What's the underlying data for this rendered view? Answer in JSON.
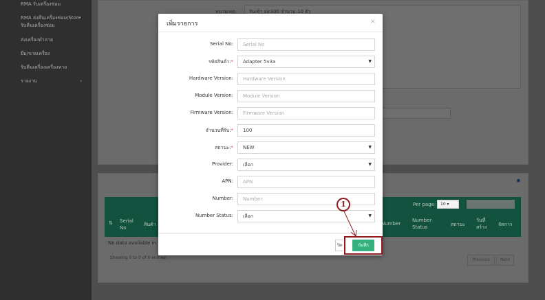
{
  "sidebar": {
    "items": [
      {
        "label": "RMA รับเครื่องซ่อม"
      },
      {
        "label": "RMA ส่งคืนเครื่องซ่อม/Store"
      },
      {
        "label": "รับคืนเครื่องซ่อม"
      },
      {
        "label": "ส่งเครื่องทำลาย"
      },
      {
        "label": "ยืม/ขายเครื่อง"
      },
      {
        "label": "รับคืนเครื่องเครื่องหาย"
      },
      {
        "label": "รายงาน",
        "arrow": "›"
      }
    ]
  },
  "background": {
    "note_label": "หมายเหตุ:",
    "note_value": "รับเข้า air300 จำนวน 10 ตัว",
    "table": {
      "per_page_label": "Per page:",
      "per_page_value": "10",
      "columns": [
        "Serial No",
        "สินค้า",
        "Number",
        "Number Status",
        "สถานะ",
        "วันที่สร้าง",
        "จัดการ"
      ],
      "empty_text": "No data available in t",
      "info_text": "Showing 0 to 0 of 0 entries",
      "previous_label": "Previous",
      "next_label": "Next"
    },
    "gear_icon": "gear-icon"
  },
  "modal": {
    "title": "เพิ่มรายการ",
    "close_glyph": "×",
    "fields": {
      "serial_no": {
        "label": "Serial No:",
        "placeholder": "Serial No",
        "value": ""
      },
      "product_code": {
        "label": "รหัสสินค้า:",
        "required": "*",
        "value": "Adapter 5v3a"
      },
      "hardware_version": {
        "label": "Hardware Version:",
        "placeholder": "Hardware Version",
        "value": ""
      },
      "module_version": {
        "label": "Module Version:",
        "placeholder": "Module Version",
        "value": ""
      },
      "firmware_version": {
        "label": "Firmware Version:",
        "placeholder": "Firmware Version",
        "value": ""
      },
      "quantity": {
        "label": "จำนวนที่รับ:",
        "required": "*",
        "value": "100"
      },
      "status": {
        "label": "สถานะ:",
        "required": "*",
        "value": "NEW"
      },
      "provider": {
        "label": "Provider:",
        "value": "เลือก"
      },
      "apn": {
        "label": "APN:",
        "placeholder": "APN",
        "value": ""
      },
      "number": {
        "label": "Number:",
        "placeholder": "Number",
        "value": ""
      },
      "number_status": {
        "label": "Number Status:",
        "value": "เลือก"
      }
    },
    "close_button_label": "ปิด",
    "save_button_label": "บันทึก"
  },
  "annotation": {
    "step_number": "1",
    "color": "#8f1c20"
  },
  "colors": {
    "accent": "#36b07e",
    "table_header": "#1d7a5f",
    "required": "#d9534f"
  }
}
